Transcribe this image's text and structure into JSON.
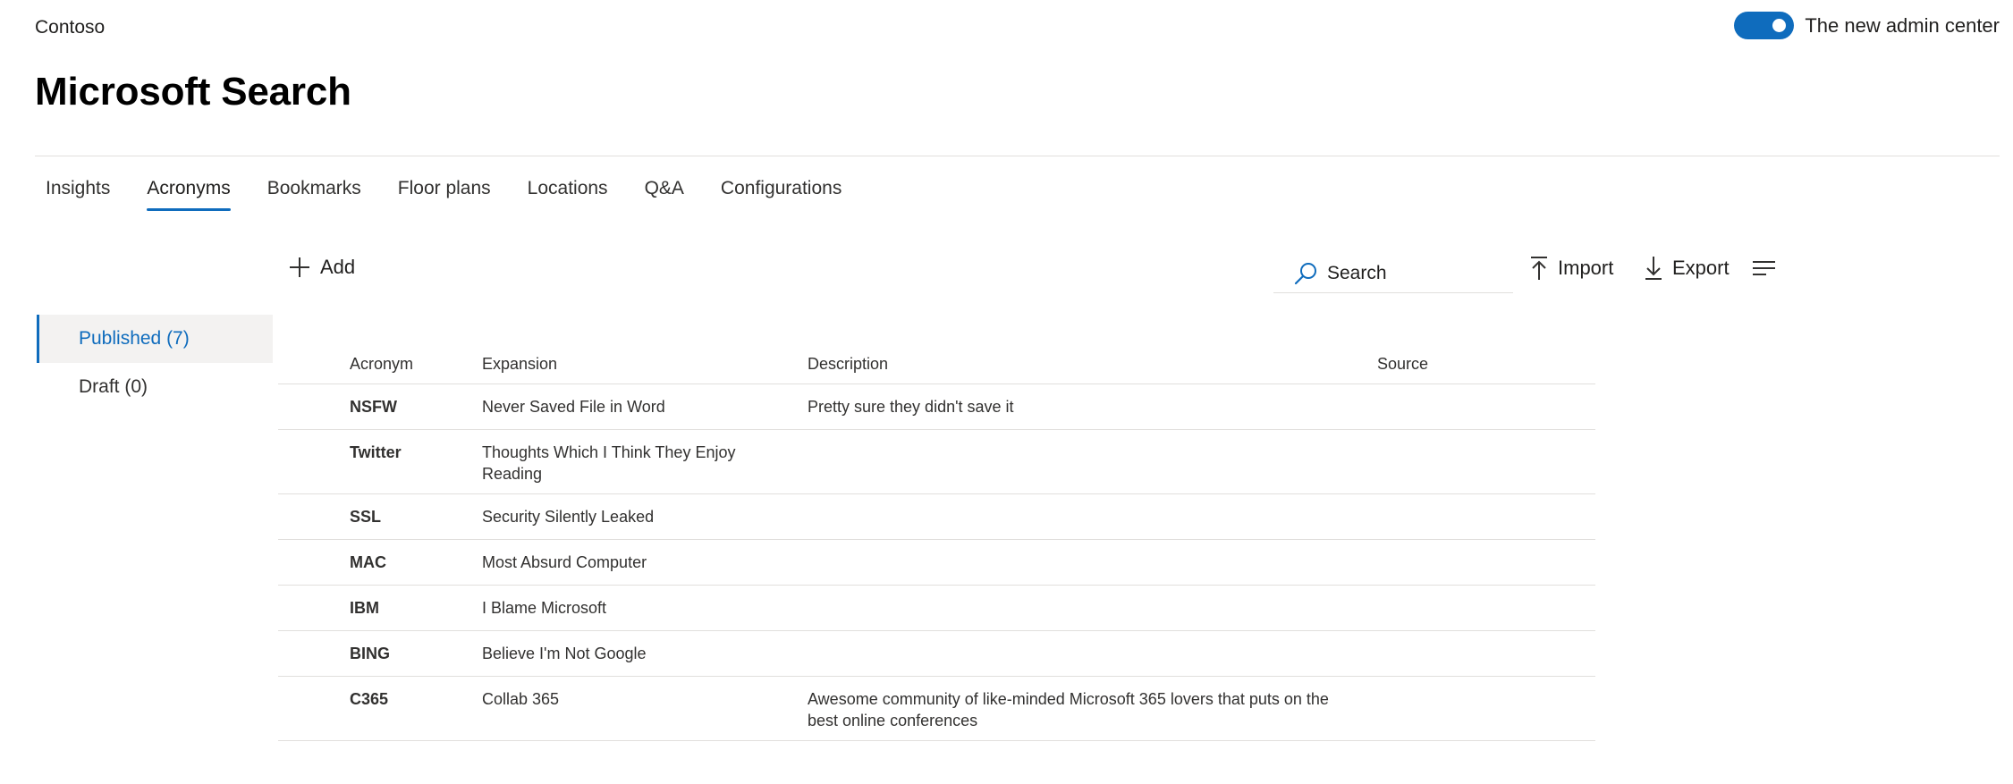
{
  "header": {
    "org_name": "Contoso",
    "admin_toggle_label": "The new admin center",
    "admin_toggle_on": true,
    "page_title": "Microsoft Search"
  },
  "tabs": [
    {
      "label": "Insights",
      "active": false
    },
    {
      "label": "Acronyms",
      "active": true
    },
    {
      "label": "Bookmarks",
      "active": false
    },
    {
      "label": "Floor plans",
      "active": false
    },
    {
      "label": "Locations",
      "active": false
    },
    {
      "label": "Q&A",
      "active": false
    },
    {
      "label": "Configurations",
      "active": false
    }
  ],
  "toolbar": {
    "add_label": "Add",
    "search_placeholder": "Search",
    "import_label": "Import",
    "export_label": "Export"
  },
  "sidebar": {
    "items": [
      {
        "label": "Published (7)",
        "active": true
      },
      {
        "label": "Draft (0)",
        "active": false
      }
    ]
  },
  "table": {
    "columns": [
      "Acronym",
      "Expansion",
      "Description",
      "Source"
    ],
    "rows": [
      {
        "acronym": "NSFW",
        "expansion": "Never Saved File in Word",
        "description": "Pretty sure they didn't save it",
        "source": ""
      },
      {
        "acronym": "Twitter",
        "expansion": "Thoughts Which I Think They Enjoy Reading",
        "description": "",
        "source": ""
      },
      {
        "acronym": "SSL",
        "expansion": "Security Silently Leaked",
        "description": "",
        "source": ""
      },
      {
        "acronym": "MAC",
        "expansion": "Most Absurd Computer",
        "description": "",
        "source": ""
      },
      {
        "acronym": "IBM",
        "expansion": "I Blame Microsoft",
        "description": "",
        "source": ""
      },
      {
        "acronym": "BING",
        "expansion": "Believe I'm Not Google",
        "description": "",
        "source": ""
      },
      {
        "acronym": "C365",
        "expansion": "Collab 365",
        "description": "Awesome community of like-minded Microsoft 365 lovers that puts on the best online conferences",
        "source": ""
      }
    ]
  },
  "colors": {
    "accent": "#0f6cbd",
    "divider": "#e1dfdd",
    "selected_bg": "#f3f2f1"
  }
}
